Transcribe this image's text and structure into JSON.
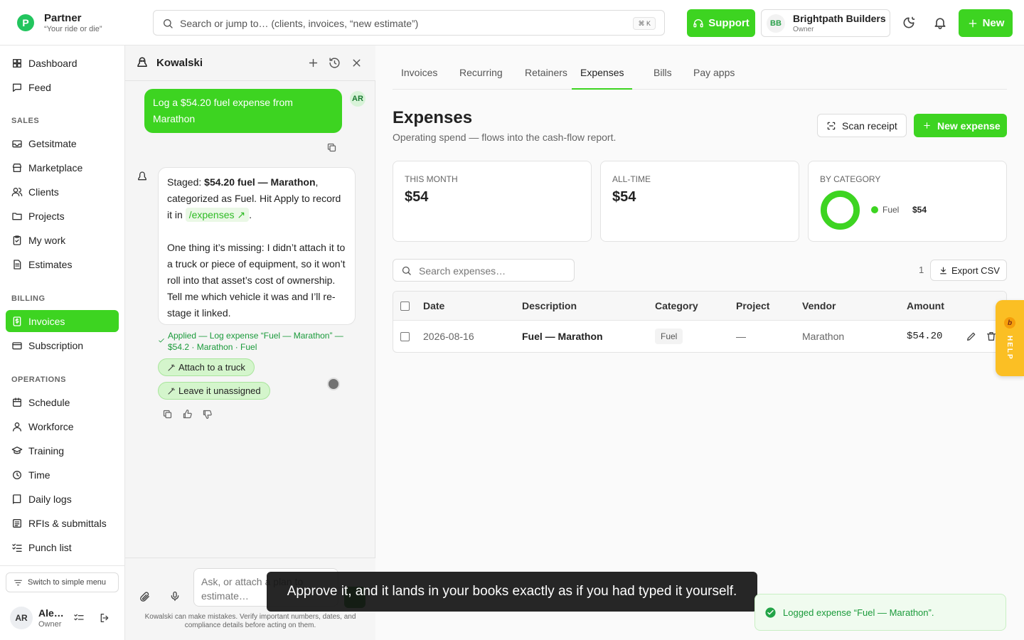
{
  "header": {
    "logo_letter": "P",
    "brand_name": "Partner",
    "brand_tagline": "“Your ride or die”",
    "search_placeholder": "Search or jump to… (clients, invoices, “new estimate”)",
    "search_shortcut": "⌘ K",
    "support_label": "Support",
    "company_initials": "BB",
    "company_name": "Brightpath Builders",
    "company_role": "Owner",
    "new_label": "New"
  },
  "sidebar": {
    "top_items": [
      {
        "label": "Dashboard",
        "icon": "grid-icon"
      },
      {
        "label": "Feed",
        "icon": "chat-icon"
      }
    ],
    "sales_heading": "SALES",
    "sales_items": [
      {
        "label": "Getsitmate",
        "icon": "mail-icon"
      },
      {
        "label": "Marketplace",
        "icon": "store-icon"
      },
      {
        "label": "Clients",
        "icon": "users-icon"
      },
      {
        "label": "Projects",
        "icon": "folder-icon"
      },
      {
        "label": "My work",
        "icon": "clipboard-check-icon"
      },
      {
        "label": "Estimates",
        "icon": "file-icon"
      }
    ],
    "billing_heading": "BILLING",
    "billing_items": [
      {
        "label": "Invoices",
        "icon": "dollar-receipt-icon",
        "active": true
      },
      {
        "label": "Subscription",
        "icon": "card-icon"
      }
    ],
    "operations_heading": "OPERATIONS",
    "operations_items": [
      {
        "label": "Schedule",
        "icon": "calendar-icon"
      },
      {
        "label": "Workforce",
        "icon": "user-icon"
      },
      {
        "label": "Training",
        "icon": "graduation-cap-icon"
      },
      {
        "label": "Time",
        "icon": "clock-icon"
      },
      {
        "label": "Daily logs",
        "icon": "book-icon"
      },
      {
        "label": "RFIs & submittals",
        "icon": "list-icon"
      },
      {
        "label": "Punch list",
        "icon": "checklist-icon"
      }
    ],
    "simple_menu_label": "Switch to simple menu",
    "user_initials": "AR",
    "user_name": "Ale…",
    "user_role": "Owner"
  },
  "chat": {
    "title": "Kowalski",
    "user_message": "Log a $54.20 fuel expense from Marathon",
    "user_initials": "AR",
    "bot": {
      "p1_a": "Staged: ",
      "p1_bold": "$54.20 fuel — Marathon",
      "p1_b": ", categorized as Fuel. Hit Apply to record it in ",
      "p1_link": "/expenses ↗",
      "p1_c": ".",
      "p2": "One thing it’s missing: I didn’t attach it to a truck or piece of equipment, so it won’t roll into that asset’s cost of ownership. Tell me which vehicle it was and I’ll re-stage it linked."
    },
    "applied_text": "Applied — Log expense “Fuel — Marathon” — $54.2 · Marathon · Fuel",
    "chip_attach": "Attach to a truck",
    "chip_leave": "Leave it unassigned",
    "composer_placeholder": "Ask, or attach a plan to estimate…",
    "disclaimer": "Kowalski can make mistakes. Verify important numbers, dates, and compliance details before acting on them."
  },
  "main": {
    "tabs": [
      "Invoices",
      "Recurring",
      "Retainers",
      "Expenses",
      "Bills",
      "Pay apps"
    ],
    "active_tab": "Expenses",
    "title": "Expenses",
    "subtitle": "Operating spend — flows into the cash-flow report.",
    "scan_label": "Scan receipt",
    "new_expense_label": "New expense",
    "cards": {
      "this_month_label": "THIS MONTH",
      "this_month_value": "$54",
      "all_time_label": "ALL-TIME",
      "all_time_value": "$54",
      "by_category_label": "BY CATEGORY",
      "category_name": "Fuel",
      "category_value": "$54",
      "category_color": "#3dd421"
    },
    "search_placeholder": "Search expenses…",
    "count": "1",
    "export_label": "Export CSV",
    "table": {
      "headers": [
        "Date",
        "Description",
        "Category",
        "Project",
        "Vendor",
        "Amount"
      ],
      "rows": [
        {
          "date": "2026-08-16",
          "description": "Fuel — Marathon",
          "category": "Fuel",
          "project": "—",
          "vendor": "Marathon",
          "amount": "$54.20"
        }
      ]
    }
  },
  "help_tab": {
    "letter": "b",
    "label": "HELP"
  },
  "caption": "Approve it, and it lands in your books exactly as if you had typed it yourself.",
  "toast": "Logged expense “Fuel — Marathon”.",
  "colors": {
    "accent": "#3dd421",
    "success_text": "#1a9a3a",
    "help": "#fbbf24"
  }
}
